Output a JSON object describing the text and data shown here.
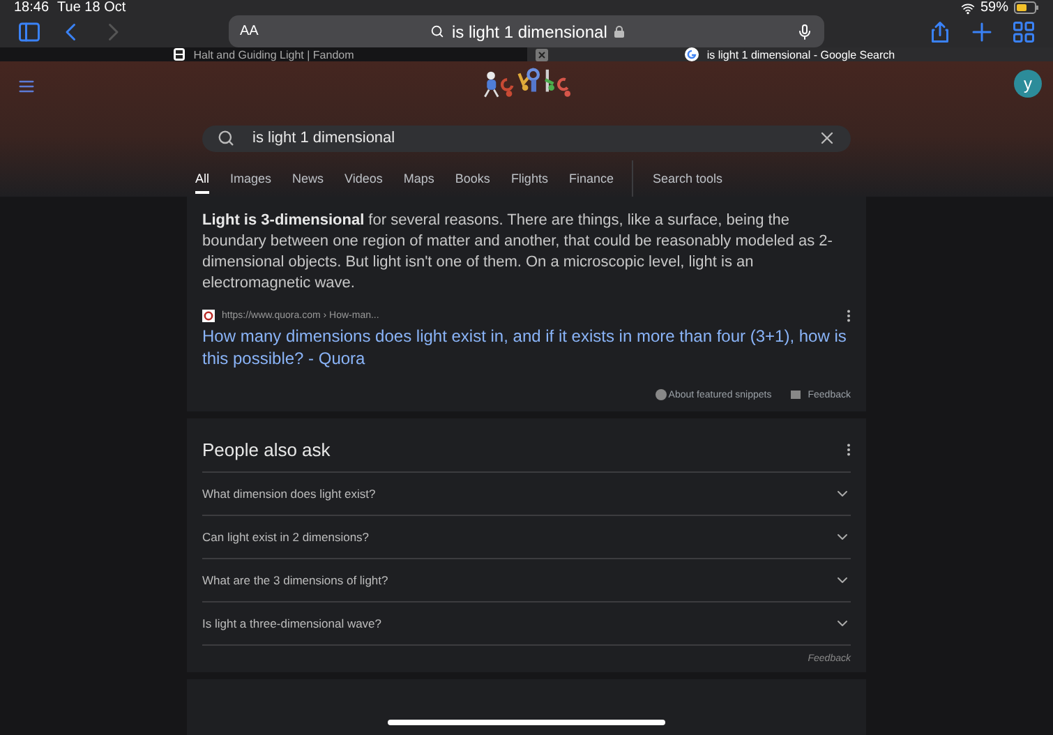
{
  "status_bar": {
    "time": "18:46",
    "date": "Tue 18 Oct",
    "battery": "59%"
  },
  "toolbar": {
    "text_size": "AA",
    "address": "is light 1 dimensional"
  },
  "tabs": [
    {
      "title": "Halt and Guiding Light | Fandom",
      "selected": false
    },
    {
      "title": "is light 1 dimensional - Google Search",
      "selected": true
    }
  ],
  "google": {
    "avatar": "y",
    "query": "is light 1 dimensional",
    "nav": [
      {
        "label": "All",
        "selected": true
      },
      {
        "label": "Images",
        "selected": false
      },
      {
        "label": "News",
        "selected": false
      },
      {
        "label": "Videos",
        "selected": false
      },
      {
        "label": "Maps",
        "selected": false
      },
      {
        "label": "Books",
        "selected": false
      },
      {
        "label": "Flights",
        "selected": false
      },
      {
        "label": "Finance",
        "selected": false
      }
    ],
    "search_tools": "Search tools"
  },
  "snippet": {
    "text": "**Light is 3-dimensional** for several reasons. There are things, like a surface, being the boundary between one region of matter and another, that could be reasonably modeled as 2-dimensional objects. But light isn't one of them. On a microscopic level, light is an electromagnetic wave.",
    "source": "https://www.quora.com › How-man...",
    "link": "How many dimensions does light exist in, and if it exists in more than four (3+1), how is this possible? - Quora",
    "about": "About featured snippets",
    "feedback": "Feedback"
  },
  "people_also_ask": {
    "title": "People also ask",
    "questions": [
      {
        "text": "What dimension does light exist?",
        "expanded": false
      },
      {
        "text": "Can light exist in 2 dimensions?",
        "expanded": false
      },
      {
        "text": "What are the 3 dimensions of light?",
        "expanded": false
      },
      {
        "text": "Is light a three-dimensional wave?",
        "expanded": false
      }
    ],
    "feedback": "Feedback"
  }
}
